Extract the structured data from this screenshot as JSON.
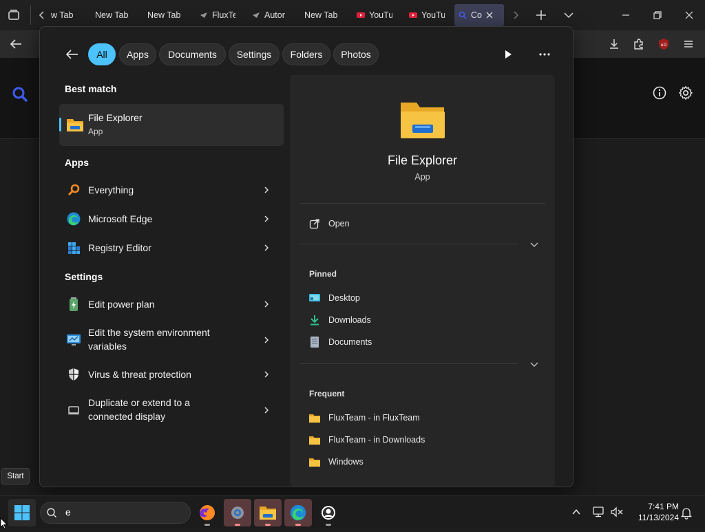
{
  "browser": {
    "tabs": [
      {
        "label": "w Tab"
      },
      {
        "label": "New Tab"
      },
      {
        "label": "New Tab"
      },
      {
        "label": "FluxTe"
      },
      {
        "label": "Autor"
      },
      {
        "label": "New Tab"
      },
      {
        "label": "YouTu"
      },
      {
        "label": "YouTu"
      },
      {
        "label": "Co"
      }
    ]
  },
  "search_filters": [
    "All",
    "Apps",
    "Documents",
    "Settings",
    "Folders",
    "Photos"
  ],
  "results": {
    "best_match_heading": "Best match",
    "best_match": {
      "title": "File Explorer",
      "subtitle": "App"
    },
    "apps_heading": "Apps",
    "apps": [
      {
        "label": "Everything",
        "icon": "magnifier-orange-icon"
      },
      {
        "label": "Microsoft Edge",
        "icon": "edge-icon"
      },
      {
        "label": "Registry Editor",
        "icon": "registry-editor-icon"
      }
    ],
    "settings_heading": "Settings",
    "settings": [
      {
        "label": "Edit power plan",
        "icon": "battery-icon"
      },
      {
        "line1": "Edit the system environment",
        "line2": "variables",
        "icon": "system-monitor-icon"
      },
      {
        "label": "Virus & threat protection",
        "icon": "shield-icon"
      },
      {
        "line1": "Duplicate or extend to a",
        "line2": "connected display",
        "icon": "display-icon"
      }
    ]
  },
  "preview": {
    "title": "File Explorer",
    "subtitle": "App",
    "open_label": "Open",
    "pinned_heading": "Pinned",
    "pinned": [
      "Desktop",
      "Downloads",
      "Documents"
    ],
    "frequent_heading": "Frequent",
    "frequent": [
      "FluxTeam - in FluxTeam",
      "FluxTeam - in Downloads",
      "Windows"
    ]
  },
  "taskbar": {
    "start_tooltip": "Start",
    "search_value": "e",
    "time": "7:41 PM",
    "date": "11/13/2024"
  },
  "colors": {
    "accent": "#4cc2ff",
    "folder_yellow": "#f6c343",
    "panel": "#1e1e1e"
  }
}
